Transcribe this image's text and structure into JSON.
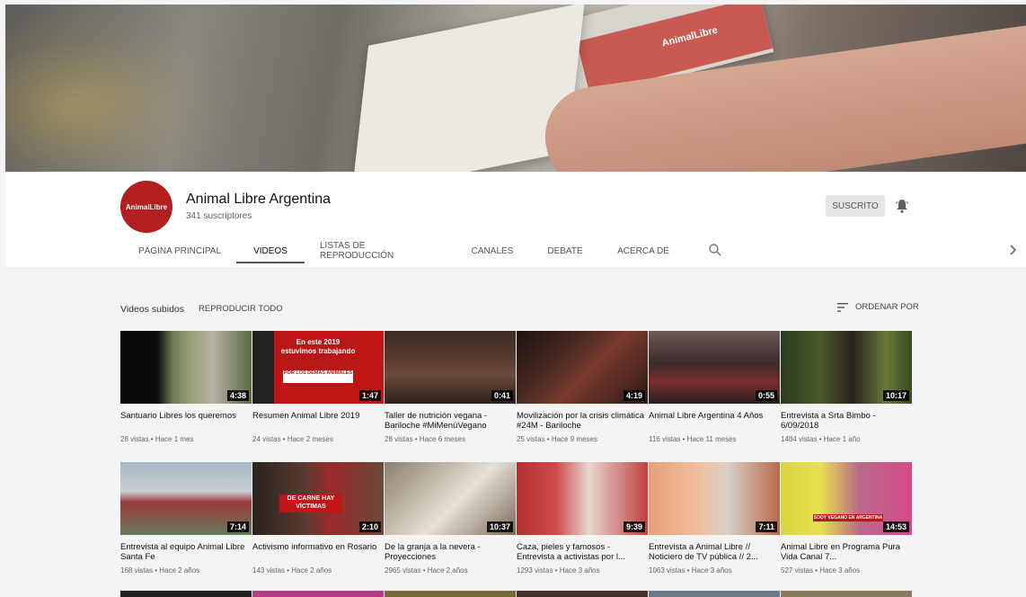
{
  "channel": {
    "name": "Animal Libre Argentina",
    "subscribers": "341 suscriptores",
    "avatar_text": "AnimalLibre",
    "subscribe_label": "SUSCRITO"
  },
  "tabs": [
    {
      "label": "PÁGINA PRINCIPAL"
    },
    {
      "label": "VIDEOS"
    },
    {
      "label": "LISTAS DE REPRODUCCIÓN"
    },
    {
      "label": "CANALES"
    },
    {
      "label": "DEBATE"
    },
    {
      "label": "ACERCA DE"
    }
  ],
  "section": {
    "title": "Videos subidos",
    "play_all": "REPRODUCIR TODO",
    "sort_label": "ORDENAR POR"
  },
  "banner": {
    "logo_text": "AnimalLibre"
  },
  "videos": [
    {
      "title": "Santuario Libres los queremos",
      "meta": "28 vistas • Hace 1 mes",
      "duration": "4:38"
    },
    {
      "title": "Resumen Animal Libre 2019",
      "meta": "24 vistas • Hace 2 meses",
      "duration": "1:47",
      "thumb_text": "En este 2019 estuvimos trabajando",
      "thumb_text2": "POR LOS DEMÁS ANIMALES"
    },
    {
      "title": "Taller de nutrición vegana - Bariloche #MiMenúVegano",
      "meta": "28 vistas • Hace 6 meses",
      "duration": "0:41"
    },
    {
      "title": "Movilización por la crisis climática #24M - Bariloche",
      "meta": "25 vistas • Hace 9 meses",
      "duration": "4:19"
    },
    {
      "title": "Animal Libre Argentina 4 Años",
      "meta": "116 vistas • Hace 11 meses",
      "duration": "0:55"
    },
    {
      "title": "Entrevista a Srta Bimbo - 6/09/2018",
      "meta": "1484 vistas • Hace 1 año",
      "duration": "10:17"
    },
    {
      "title": "Entrevista al equipo Animal Libre Santa Fe",
      "meta": "168 vistas • Hace 2 años",
      "duration": "7:14"
    },
    {
      "title": "Activismo informativo en Rosario",
      "meta": "143 vistas • Hace 2 años",
      "duration": "2:10",
      "thumb_text": "DE CARNE HAY VÍCTIMAS"
    },
    {
      "title": "De la granja a la nevera - Proyecciones",
      "meta": "2965 vistas • Hace 2 años",
      "duration": "10:37"
    },
    {
      "title": "Caza, pieles y famosos - Entrevista a activistas por l...",
      "meta": "1293 vistas • Hace 3 años",
      "duration": "9:39"
    },
    {
      "title": "Entrevista a Animal Libre // Noticiero de TV pública // 2...",
      "meta": "1063 vistas • Hace 3 años",
      "duration": "7:11"
    },
    {
      "title": "Animal Libre en Programa Pura Vida Canal 7...",
      "meta": "527 vistas • Hace 3 años",
      "duration": "14:53",
      "thumb_text": "SOOY VEGANO EN ARGENTINA"
    }
  ],
  "colors": {
    "avatar_bg": "#b21f1f",
    "page_bg": "#f4f4f4"
  }
}
